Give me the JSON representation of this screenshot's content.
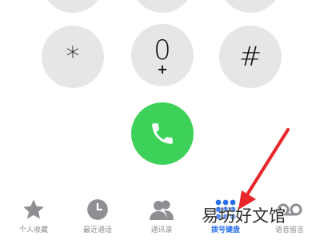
{
  "keypad": {
    "keys": [
      {
        "main": "*",
        "sub": ""
      },
      {
        "main": "0",
        "sub": "+"
      },
      {
        "main": "#",
        "sub": ""
      }
    ]
  },
  "call_button": {
    "icon": "phone-icon",
    "color": "#3dd15a"
  },
  "tab_bar": {
    "items": [
      {
        "label": "个人收藏",
        "icon": "star-icon"
      },
      {
        "label": "最近通话",
        "icon": "clock-icon"
      },
      {
        "label": "通讯录",
        "icon": "contacts-icon"
      },
      {
        "label": "拨号键盘",
        "icon": "keypad-icon",
        "active": true
      },
      {
        "label": "语音留言",
        "icon": "voicemail-icon"
      }
    ],
    "active_color": "#2a6ff0"
  },
  "watermark": {
    "text": "易坊好文馆"
  },
  "annotation": {
    "arrow_color": "#e8262a"
  }
}
